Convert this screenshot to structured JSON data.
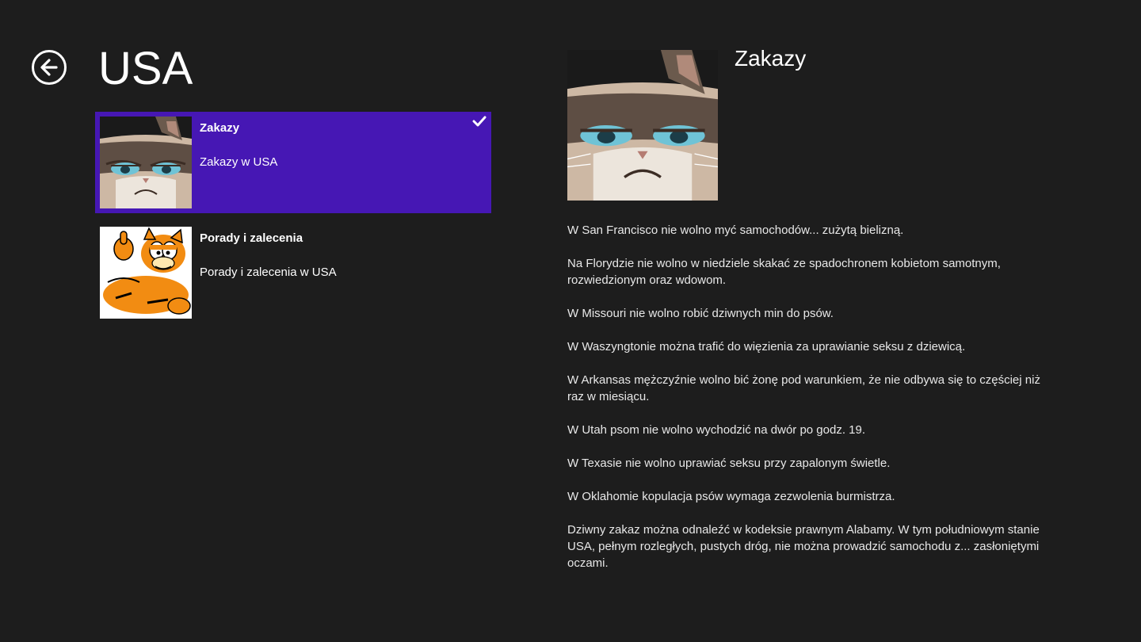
{
  "page": {
    "title": "USA",
    "accent": "#4617b4",
    "background": "#1d1d1d"
  },
  "icons": {
    "back": "arrow-left-circle-icon",
    "check": "checkmark-icon"
  },
  "list": {
    "items": [
      {
        "title": "Zakazy",
        "subtitle": "Zakazy w USA",
        "selected": true,
        "image": "grumpy-cat"
      },
      {
        "title": "Porady i zalecenia",
        "subtitle": "Porady i zalecenia w USA",
        "selected": false,
        "image": "garfield"
      }
    ]
  },
  "detail": {
    "title": "Zakazy",
    "image": "grumpy-cat",
    "paragraphs": [
      "W San Francisco nie wolno myć samochodów... zużytą bielizną.",
      "Na Florydzie nie wolno w niedziele skakać ze spadochronem kobietom samotnym, rozwiedzionym oraz wdowom.",
      "W Missouri nie wolno robić dziwnych min do psów.",
      "W Waszyngtonie można trafić do więzienia za uprawianie seksu z dziewicą.",
      "W Arkansas mężczyźnie wolno bić żonę pod warunkiem, że nie odbywa się to częściej niż raz w miesiącu.",
      "W Utah psom nie wolno wychodzić na dwór po godz. 19.",
      "W Texasie nie wolno uprawiać seksu przy zapalonym świetle.",
      "W Oklahomie kopulacja psów wymaga zezwolenia burmistrza.",
      "Dziwny zakaz można odnaleźć w kodeksie prawnym Alabamy. W tym południowym stanie USA, pełnym rozległych, pustych dróg, nie można prowadzić samochodu z... zasłoniętymi oczami."
    ]
  }
}
